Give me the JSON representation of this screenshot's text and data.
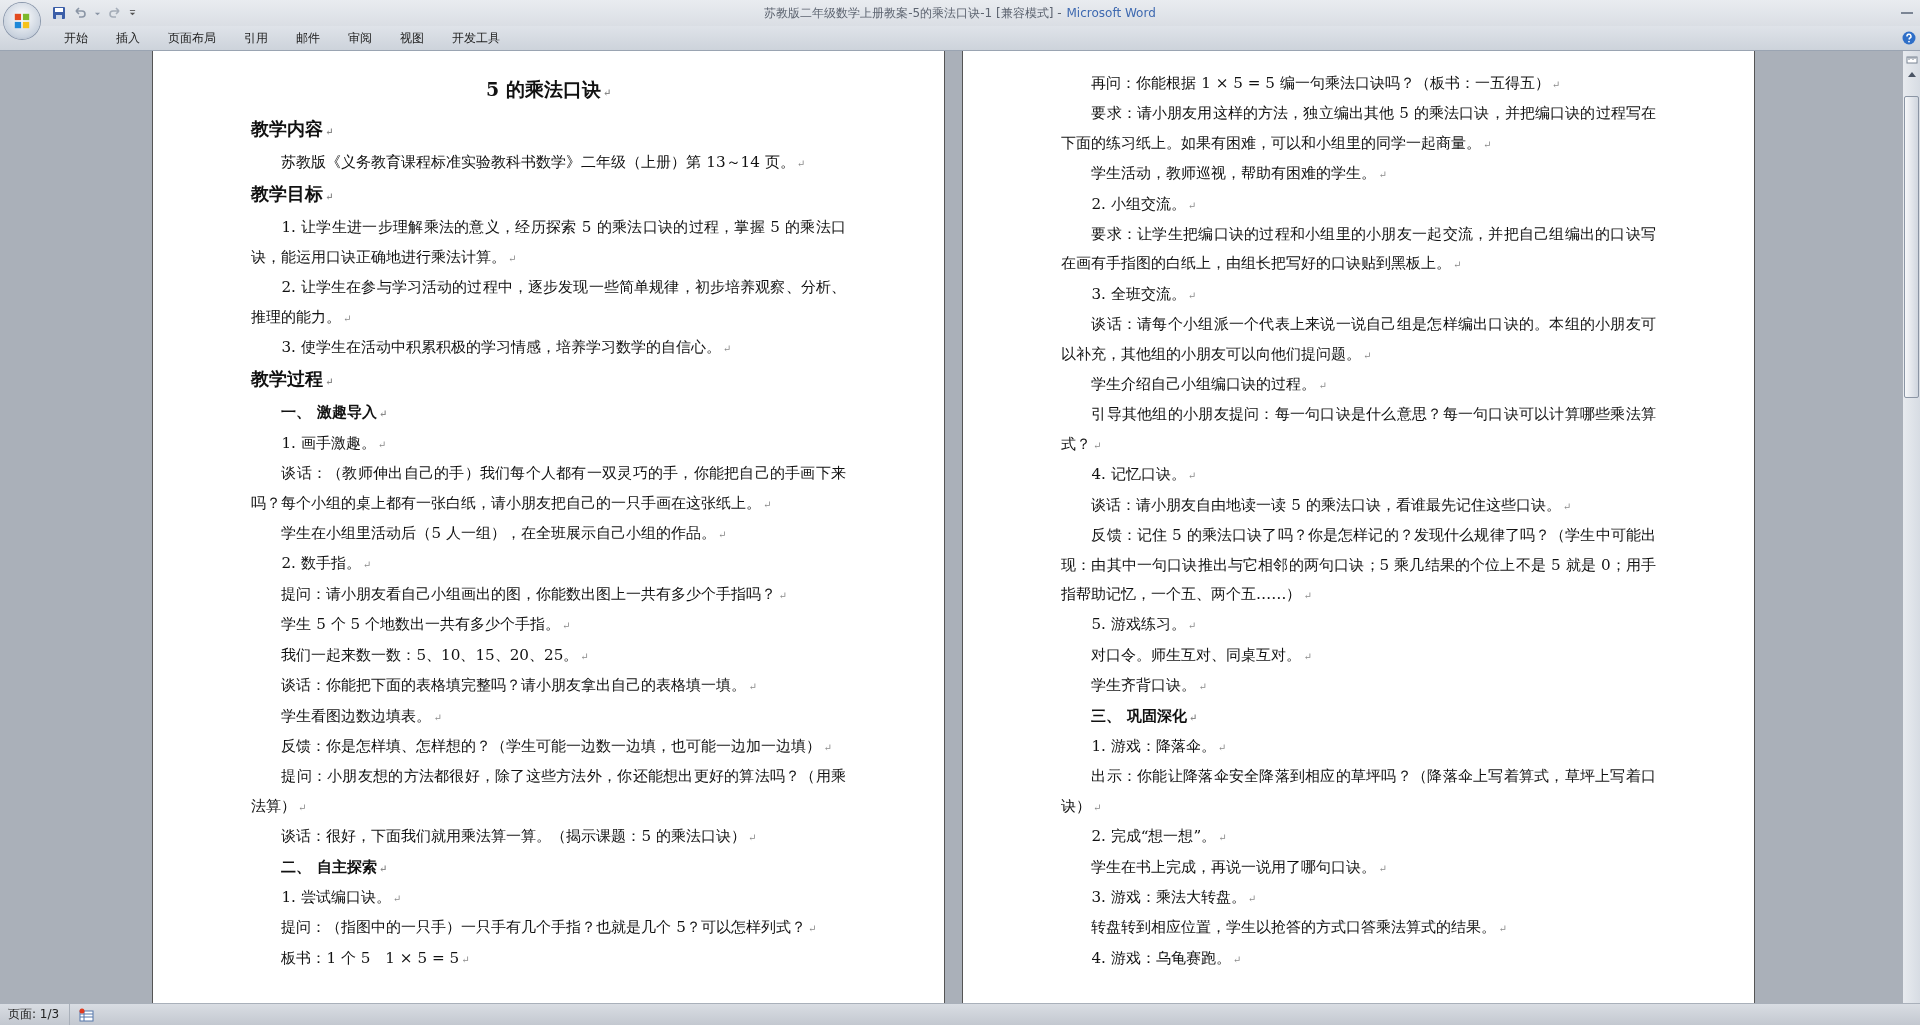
{
  "window": {
    "title": "苏教版二年级数学上册教案-5的乘法口诀-1 [兼容模式] -",
    "app_name": "Microsoft Word"
  },
  "ribbon_tabs": [
    {
      "label": "开始",
      "selected": false
    },
    {
      "label": "插入",
      "selected": false
    },
    {
      "label": "页面布局",
      "selected": false
    },
    {
      "label": "引用",
      "selected": false
    },
    {
      "label": "邮件",
      "selected": false
    },
    {
      "label": "审阅",
      "selected": false
    },
    {
      "label": "视图",
      "selected": false
    },
    {
      "label": "开发工具",
      "selected": false
    }
  ],
  "pages": [
    {
      "blocks": [
        {
          "kind": "title",
          "text": "5 的乘法口诀",
          "mark": "↵"
        },
        {
          "kind": "heading",
          "text": "教学内容",
          "mark": "↵"
        },
        {
          "kind": "para",
          "text": "苏教版《义务教育课程标准实验教科书数学》二年级（上册）第 13～14 页。",
          "mark": "↵"
        },
        {
          "kind": "heading",
          "text": "教学目标",
          "mark": "↵"
        },
        {
          "kind": "para",
          "text": "1. 让学生进一步理解乘法的意义，经历探索 5 的乘法口诀的过程，掌握 5 的乘法口诀，能运用口诀正确地进行乘法计算。",
          "mark": "↵"
        },
        {
          "kind": "para",
          "text": "2. 让学生在参与学习活动的过程中，逐步发现一些简单规律，初步培养观察、分析、推理的能力。",
          "mark": "↵"
        },
        {
          "kind": "para",
          "text": "3. 使学生在活动中积累积极的学习情感，培养学习数学的自信心。",
          "mark": "↵"
        },
        {
          "kind": "heading",
          "text": "教学过程",
          "mark": "↵"
        },
        {
          "kind": "section",
          "text": "一、 激趣导入",
          "mark": "↵"
        },
        {
          "kind": "para",
          "text": "1. 画手激趣。",
          "mark": "↵"
        },
        {
          "kind": "para",
          "text": "谈话：（教师伸出自己的手）我们每个人都有一双灵巧的手，你能把自己的手画下来吗？每个小组的桌上都有一张白纸，请小朋友把自己的一只手画在这张纸上。",
          "mark": "↵"
        },
        {
          "kind": "para",
          "text": "学生在小组里活动后（5 人一组），在全班展示自己小组的作品。",
          "mark": "↵"
        },
        {
          "kind": "para",
          "text": "2. 数手指。",
          "mark": "↵"
        },
        {
          "kind": "para",
          "text": "提问：请小朋友看自己小组画出的图，你能数出图上一共有多少个手指吗？",
          "mark": "↵"
        },
        {
          "kind": "para",
          "text": "学生 5 个 5 个地数出一共有多少个手指。",
          "mark": "↵"
        },
        {
          "kind": "para",
          "text": "我们一起来数一数：5、10、15、20、25。",
          "mark": "↵"
        },
        {
          "kind": "para",
          "text": "谈话：你能把下面的表格填完整吗？请小朋友拿出自己的表格填一填。",
          "mark": "↵"
        },
        {
          "kind": "para",
          "text": "学生看图边数边填表。",
          "mark": "↵"
        },
        {
          "kind": "para",
          "text": "反馈：你是怎样填、怎样想的？（学生可能一边数一边填，也可能一边加一边填）",
          "mark": "↵"
        },
        {
          "kind": "para",
          "text": "提问：小朋友想的方法都很好，除了这些方法外，你还能想出更好的算法吗？（用乘法算）",
          "mark": "↵"
        },
        {
          "kind": "para",
          "text": "谈话：很好，下面我们就用乘法算一算。（揭示课题：5 的乘法口诀）",
          "mark": "↵"
        },
        {
          "kind": "section",
          "text": "二、 自主探索",
          "mark": "↵"
        },
        {
          "kind": "para",
          "text": "1. 尝试编口诀。",
          "mark": "↵"
        },
        {
          "kind": "para",
          "text": "提问：（指图中的一只手）一只手有几个手指？也就是几个 5？可以怎样列式？",
          "mark": "↵"
        },
        {
          "kind": "para",
          "text": "板书：1 个 5　1 × 5 = 5",
          "mark": "↵"
        }
      ]
    },
    {
      "blocks": [
        {
          "kind": "para",
          "text": "再问：你能根据 1 × 5 = 5 编一句乘法口诀吗？（板书：一五得五）",
          "mark": "↵"
        },
        {
          "kind": "para",
          "text": "要求：请小朋友用这样的方法，独立编出其他 5 的乘法口诀，并把编口诀的过程写在下面的练习纸上。如果有困难，可以和小组里的同学一起商量。",
          "mark": "↵"
        },
        {
          "kind": "para",
          "text": "学生活动，教师巡视，帮助有困难的学生。",
          "mark": "↵"
        },
        {
          "kind": "para",
          "text": "2. 小组交流。",
          "mark": "↵"
        },
        {
          "kind": "para",
          "text": "要求：让学生把编口诀的过程和小组里的小朋友一起交流，并把自己组编出的口诀写在画有手指图的白纸上，由组长把写好的口诀贴到黑板上。",
          "mark": "↵"
        },
        {
          "kind": "para",
          "text": "3. 全班交流。",
          "mark": "↵"
        },
        {
          "kind": "para",
          "text": "谈话：请每个小组派一个代表上来说一说自己组是怎样编出口诀的。本组的小朋友可以补充，其他组的小朋友可以向他们提问题。",
          "mark": "↵"
        },
        {
          "kind": "para",
          "text": "学生介绍自己小组编口诀的过程。",
          "mark": "↵"
        },
        {
          "kind": "para",
          "text": "引导其他组的小朋友提问：每一句口诀是什么意思？每一句口诀可以计算哪些乘法算式？",
          "mark": "↵"
        },
        {
          "kind": "para",
          "text": "4. 记忆口诀。",
          "mark": "↵"
        },
        {
          "kind": "para",
          "text": "谈话：请小朋友自由地读一读 5 的乘法口诀，看谁最先记住这些口诀。",
          "mark": "↵"
        },
        {
          "kind": "para",
          "text": "反馈：记住 5 的乘法口诀了吗？你是怎样记的？发现什么规律了吗？（学生中可能出现：由其中一句口诀推出与它相邻的两句口诀；5 乘几结果的个位上不是 5 就是 0；用手指帮助记忆，一个五、两个五……）",
          "mark": "↵"
        },
        {
          "kind": "para",
          "text": "5. 游戏练习。",
          "mark": "↵"
        },
        {
          "kind": "para",
          "text": "对口令。师生互对、同桌互对。",
          "mark": "↵"
        },
        {
          "kind": "para",
          "text": "学生齐背口诀。",
          "mark": "↵"
        },
        {
          "kind": "section",
          "text": "三、 巩固深化",
          "mark": "↵"
        },
        {
          "kind": "para",
          "text": "1. 游戏：降落伞。",
          "mark": "↵"
        },
        {
          "kind": "para",
          "text": "出示：你能让降落伞安全降落到相应的草坪吗？（降落伞上写着算式，草坪上写着口诀）",
          "mark": "↵"
        },
        {
          "kind": "para",
          "text": "2. 完成“想一想”。",
          "mark": "↵"
        },
        {
          "kind": "para",
          "text": "学生在书上完成，再说一说用了哪句口诀。",
          "mark": "↵"
        },
        {
          "kind": "para",
          "text": "3. 游戏：乘法大转盘。",
          "mark": "↵"
        },
        {
          "kind": "para",
          "text": "转盘转到相应位置，学生以抢答的方式口答乘法算式的结果。",
          "mark": "↵"
        },
        {
          "kind": "para",
          "text": "4. 游戏：乌龟赛跑。",
          "mark": "↵"
        }
      ]
    }
  ],
  "status_bar": {
    "page": "页面: 1/3"
  }
}
